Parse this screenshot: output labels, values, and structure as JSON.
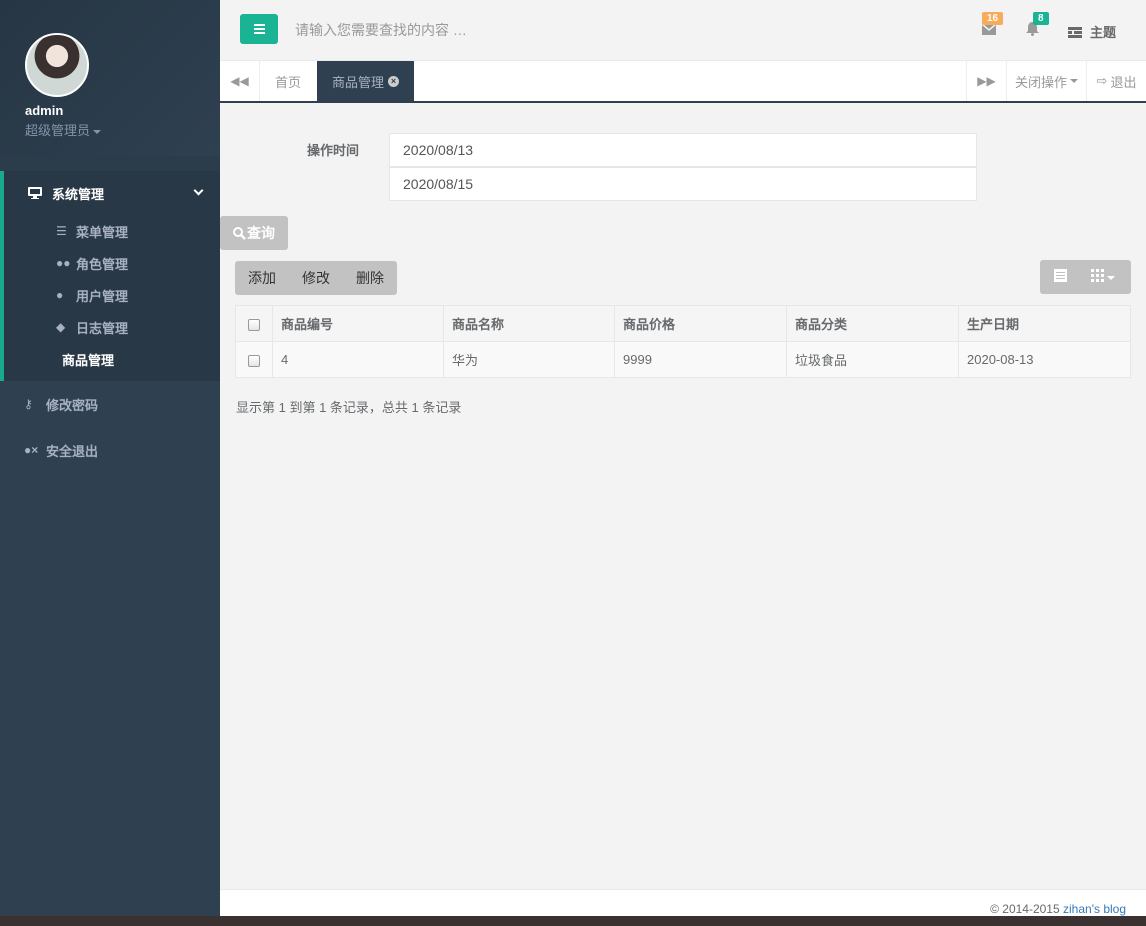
{
  "user": {
    "name": "admin",
    "role": "超级管理员"
  },
  "nav": {
    "group_label": "系统管理",
    "sub_items": [
      {
        "label": "菜单管理",
        "icon": "sliders-icon"
      },
      {
        "label": "角色管理",
        "icon": "users-icon"
      },
      {
        "label": "用户管理",
        "icon": "user-icon"
      },
      {
        "label": "日志管理",
        "icon": "tags-icon"
      },
      {
        "label": "商品管理",
        "icon": ""
      }
    ],
    "change_password": "修改密码",
    "logout": "安全退出"
  },
  "topbar": {
    "search_placeholder": "请输入您需要查找的内容 …",
    "mail_count": "16",
    "notify_count": "8",
    "theme_label": "主题"
  },
  "tabs": {
    "home": "首页",
    "active": "商品管理",
    "close_ops": "关闭操作",
    "exit": "退出"
  },
  "form": {
    "label": "操作时间",
    "start_date": "2020/08/13",
    "end_date": "2020/08/15",
    "query": "查询"
  },
  "toolbar": {
    "add": "添加",
    "edit": "修改",
    "delete": "删除"
  },
  "table": {
    "headers": [
      "商品编号",
      "商品名称",
      "商品价格",
      "商品分类",
      "生产日期"
    ],
    "rows": [
      [
        "4",
        "华为",
        "9999",
        "垃圾食品",
        "2020-08-13"
      ]
    ],
    "summary": "显示第 1 到第 1 条记录，总共 1 条记录"
  },
  "footer": {
    "copyright": "© 2014-2015",
    "link": "zihan's blog"
  },
  "colors": {
    "accent": "#1ab394",
    "sidebar": "#2f4050",
    "mail_badge": "#f8ac59",
    "notify_badge": "#1c84c6"
  }
}
